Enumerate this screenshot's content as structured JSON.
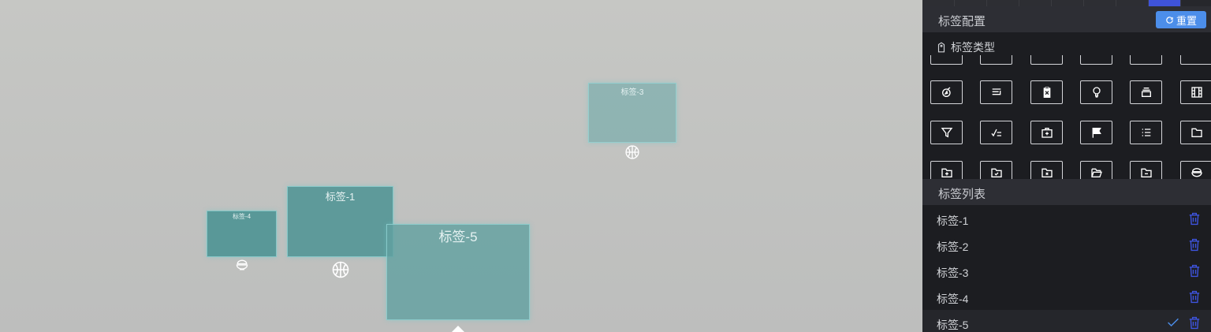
{
  "scene": {
    "tags": [
      {
        "id": "tag-1",
        "label": "标签-1",
        "marker": "basketball-icon"
      },
      {
        "id": "tag-3",
        "label": "标签-3",
        "marker": "basketball-icon"
      },
      {
        "id": "tag-4",
        "label": "标签-4",
        "marker": "rice-bowl-icon"
      },
      {
        "id": "tag-5",
        "label": "标签-5"
      }
    ]
  },
  "panel": {
    "header": {
      "title": "标签配置",
      "reset_label": "重置",
      "reset_icon": "refresh-icon"
    },
    "tag_type": {
      "title": "标签类型",
      "icon": "tag-icon"
    },
    "icons": [
      "compass-icon",
      "align-right-icon",
      "clipboard-x-icon",
      "bulb-icon",
      "box-icon",
      "film-icon",
      "filter-icon",
      "check-list-icon",
      "first-aid-icon",
      "flag-icon",
      "list-icon",
      "folder-icon",
      "folder-add-icon",
      "folder-check-icon",
      "folder-x-icon",
      "folder-open-icon",
      "folder-minus-icon",
      "rice-bowl-icon"
    ],
    "list": {
      "title": "标签列表",
      "items": [
        {
          "label": "标签-1",
          "selected": false
        },
        {
          "label": "标签-2",
          "selected": false
        },
        {
          "label": "标签-3",
          "selected": false
        },
        {
          "label": "标签-4",
          "selected": false
        },
        {
          "label": "标签-5",
          "selected": true
        }
      ]
    },
    "colors": {
      "accent": "#4c8eea",
      "trash": "#3e54e0",
      "panel_bg": "#1c1d21",
      "tag_fill": "#4f9595"
    }
  }
}
